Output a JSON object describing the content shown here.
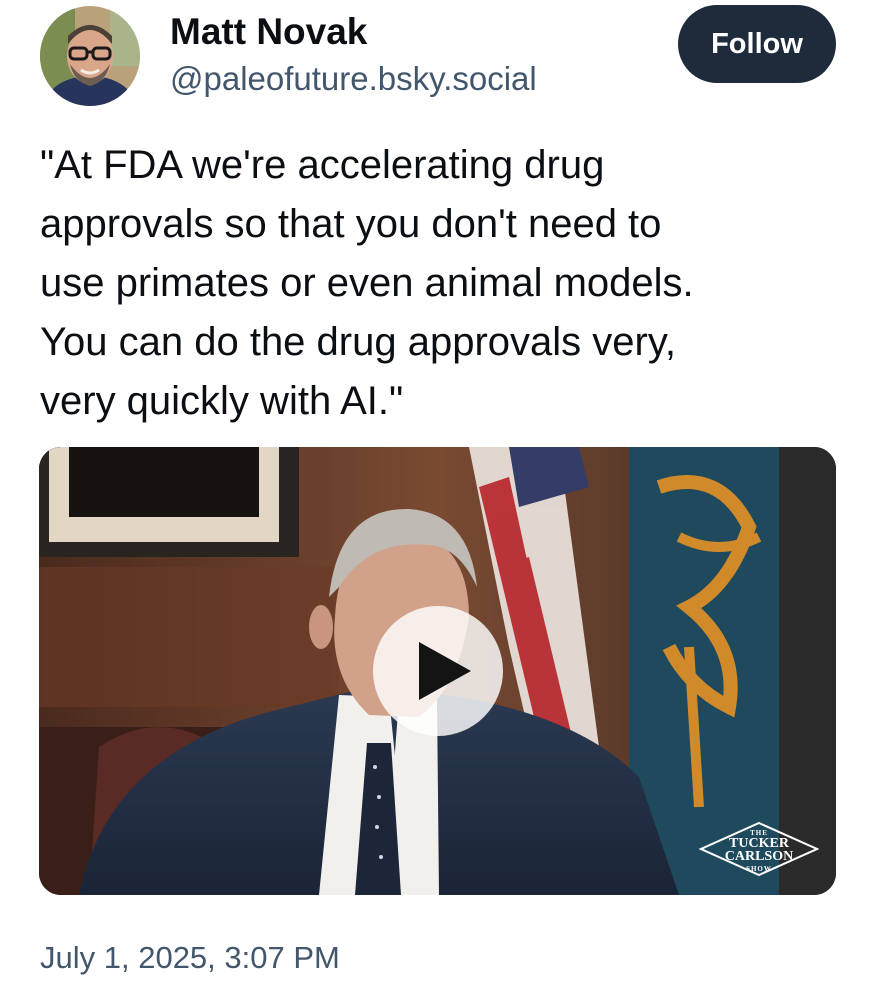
{
  "post": {
    "author": {
      "display_name": "Matt Novak",
      "handle": "@paleofuture.bsky.social",
      "avatar_icon": "avatar-photo"
    },
    "follow_label": "Follow",
    "text_lines": [
      "\"At FDA we're accelerating drug",
      "approvals so that you don't need to",
      "use primates or even animal models.",
      "You can do the drug approvals very,",
      "very quickly with AI.\""
    ],
    "video": {
      "play_icon": "play-icon",
      "watermark": {
        "top": "THE",
        "line1": "TUCKER",
        "line2": "CARLSON",
        "bottom": "SHOW"
      }
    },
    "timestamp": "July 1, 2025, 3:07 PM"
  },
  "colors": {
    "follow_button_bg": "#1e2b3a",
    "secondary_text": "#42576c",
    "primary_text": "#0b0f14"
  }
}
